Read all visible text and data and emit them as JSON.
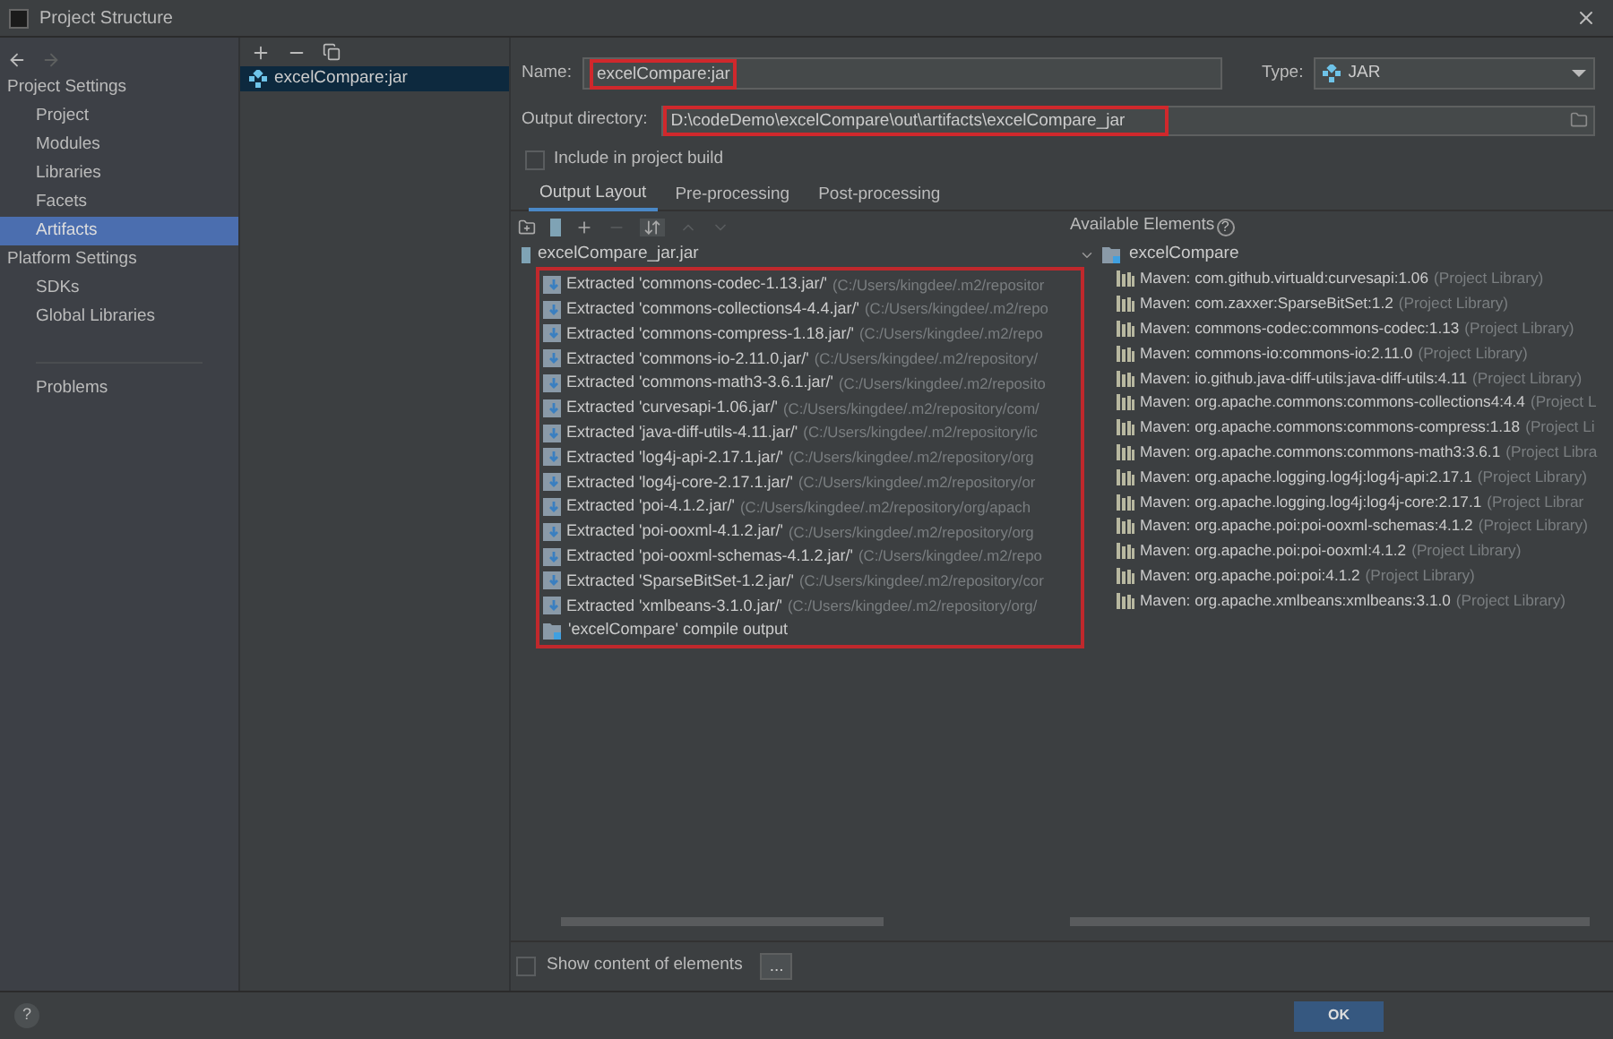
{
  "window": {
    "title": "Project Structure"
  },
  "sidebar": {
    "items": [
      {
        "kind": "header",
        "label": "Project Settings",
        "selected": false
      },
      {
        "kind": "item",
        "label": "Project",
        "selected": false
      },
      {
        "kind": "item",
        "label": "Modules",
        "selected": false
      },
      {
        "kind": "item",
        "label": "Libraries",
        "selected": false
      },
      {
        "kind": "item",
        "label": "Facets",
        "selected": false
      },
      {
        "kind": "item",
        "label": "Artifacts",
        "selected": true
      },
      {
        "kind": "header",
        "label": "Platform Settings",
        "selected": false
      },
      {
        "kind": "item",
        "label": "SDKs",
        "selected": false
      },
      {
        "kind": "item",
        "label": "Global Libraries",
        "selected": false
      },
      {
        "kind": "divider"
      },
      {
        "kind": "item",
        "label": "Problems",
        "selected": false
      }
    ]
  },
  "artifacts": {
    "items": [
      {
        "label": "excelCompare:jar",
        "selected": true
      }
    ]
  },
  "form": {
    "name_label": "Name:",
    "name_value": "excelCompare:jar",
    "type_label": "Type:",
    "type_value": "JAR",
    "output_label": "Output directory:",
    "output_value": "D:\\codeDemo\\excelCompare\\out\\artifacts\\excelCompare_jar",
    "include_label": "Include in project build",
    "include_checked": false
  },
  "tabs": [
    {
      "label": "Output Layout",
      "selected": true
    },
    {
      "label": "Pre-processing",
      "selected": false
    },
    {
      "label": "Post-processing",
      "selected": false
    }
  ],
  "layout_tree": {
    "label": "excelCompare_jar.jar",
    "children": [
      {
        "kind": "extracted",
        "label": "Extracted 'commons-codec-1.13.jar/'",
        "path": "(C:/Users/kingdee/.m2/repositor"
      },
      {
        "kind": "extracted",
        "label": "Extracted 'commons-collections4-4.4.jar/'",
        "path": "(C:/Users/kingdee/.m2/repo"
      },
      {
        "kind": "extracted",
        "label": "Extracted 'commons-compress-1.18.jar/'",
        "path": "(C:/Users/kingdee/.m2/repo"
      },
      {
        "kind": "extracted",
        "label": "Extracted 'commons-io-2.11.0.jar/'",
        "path": "(C:/Users/kingdee/.m2/repository/"
      },
      {
        "kind": "extracted",
        "label": "Extracted 'commons-math3-3.6.1.jar/'",
        "path": "(C:/Users/kingdee/.m2/reposito"
      },
      {
        "kind": "extracted",
        "label": "Extracted 'curvesapi-1.06.jar/'",
        "path": "(C:/Users/kingdee/.m2/repository/com/"
      },
      {
        "kind": "extracted",
        "label": "Extracted 'java-diff-utils-4.11.jar/'",
        "path": "(C:/Users/kingdee/.m2/repository/ic"
      },
      {
        "kind": "extracted",
        "label": "Extracted 'log4j-api-2.17.1.jar/'",
        "path": "(C:/Users/kingdee/.m2/repository/org"
      },
      {
        "kind": "extracted",
        "label": "Extracted 'log4j-core-2.17.1.jar/'",
        "path": "(C:/Users/kingdee/.m2/repository/or"
      },
      {
        "kind": "extracted",
        "label": "Extracted 'poi-4.1.2.jar/'",
        "path": "(C:/Users/kingdee/.m2/repository/org/apach"
      },
      {
        "kind": "extracted",
        "label": "Extracted 'poi-ooxml-4.1.2.jar/'",
        "path": "(C:/Users/kingdee/.m2/repository/org"
      },
      {
        "kind": "extracted",
        "label": "Extracted 'poi-ooxml-schemas-4.1.2.jar/'",
        "path": "(C:/Users/kingdee/.m2/repo"
      },
      {
        "kind": "extracted",
        "label": "Extracted 'SparseBitSet-1.2.jar/'",
        "path": "(C:/Users/kingdee/.m2/repository/cor"
      },
      {
        "kind": "extracted",
        "label": "Extracted 'xmlbeans-3.1.0.jar/'",
        "path": "(C:/Users/kingdee/.m2/repository/org/"
      },
      {
        "kind": "output",
        "label": "'excelCompare' compile output"
      }
    ]
  },
  "available": {
    "title": "Available Elements",
    "help": "?",
    "root": {
      "label": "excelCompare",
      "expanded": true,
      "children": [
        {
          "label": "Maven: com.github.virtuald:curvesapi:1.06",
          "note": "(Project Library)"
        },
        {
          "label": "Maven: com.zaxxer:SparseBitSet:1.2",
          "note": "(Project Library)"
        },
        {
          "label": "Maven: commons-codec:commons-codec:1.13",
          "note": "(Project Library)"
        },
        {
          "label": "Maven: commons-io:commons-io:2.11.0",
          "note": "(Project Library)"
        },
        {
          "label": "Maven: io.github.java-diff-utils:java-diff-utils:4.11",
          "note": "(Project Library)"
        },
        {
          "label": "Maven: org.apache.commons:commons-collections4:4.4",
          "note": "(Project L"
        },
        {
          "label": "Maven: org.apache.commons:commons-compress:1.18",
          "note": "(Project Li"
        },
        {
          "label": "Maven: org.apache.commons:commons-math3:3.6.1",
          "note": "(Project Libra"
        },
        {
          "label": "Maven: org.apache.logging.log4j:log4j-api:2.17.1",
          "note": "(Project Library)"
        },
        {
          "label": "Maven: org.apache.logging.log4j:log4j-core:2.17.1",
          "note": "(Project Librar"
        },
        {
          "label": "Maven: org.apache.poi:poi-ooxml-schemas:4.1.2",
          "note": "(Project Library)"
        },
        {
          "label": "Maven: org.apache.poi:poi-ooxml:4.1.2",
          "note": "(Project Library)"
        },
        {
          "label": "Maven: org.apache.poi:poi:4.1.2",
          "note": "(Project Library)"
        },
        {
          "label": "Maven: org.apache.xmlbeans:xmlbeans:3.1.0",
          "note": "(Project Library)"
        }
      ]
    }
  },
  "show_content": {
    "label": "Show content of elements",
    "checked": false,
    "button": "..."
  },
  "footer": {
    "help": "?",
    "ok": "OK"
  }
}
